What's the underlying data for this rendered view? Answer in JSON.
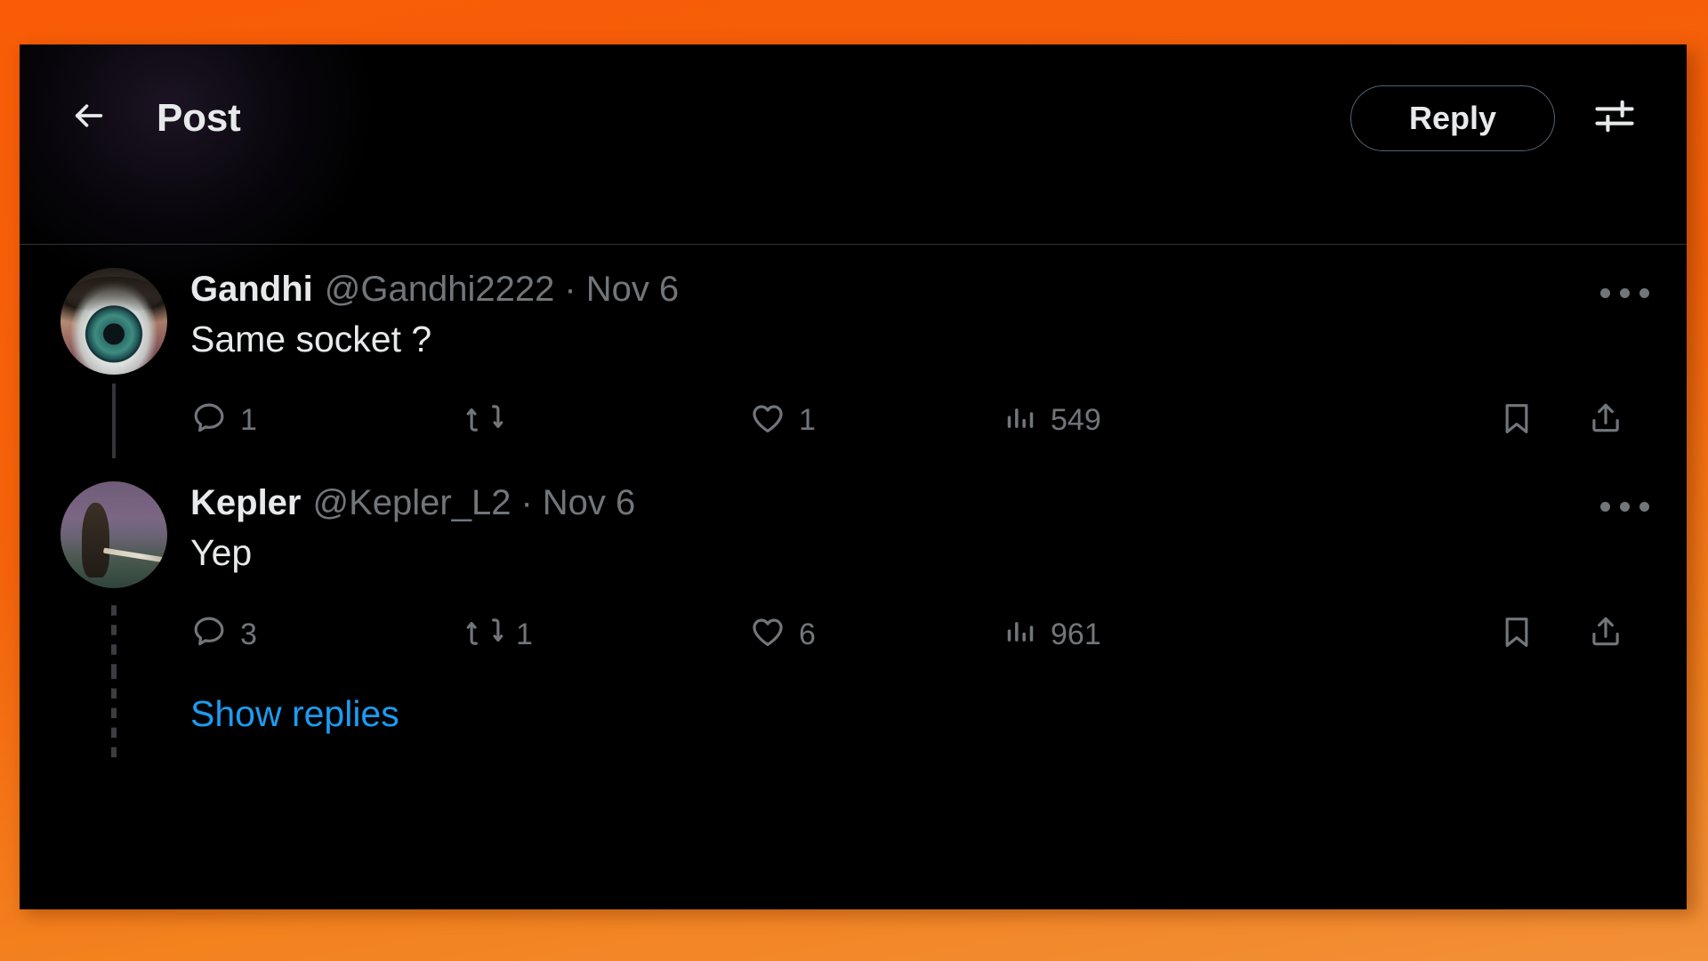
{
  "theme": {
    "frame_color": "#f4620a",
    "app_background": "#000000",
    "text_primary": "#e7e9ea",
    "text_secondary": "#71767b",
    "link_color": "#1d9bf0",
    "border_color": "#2f3336"
  },
  "header": {
    "back_icon": "arrow-left-icon",
    "title": "Post",
    "reply_label": "Reply",
    "settings_icon": "sliders-icon"
  },
  "posts": [
    {
      "avatar_style": "eye",
      "display_name": "Gandhi",
      "handle": "@Gandhi2222",
      "separator": "·",
      "date": "Nov 6",
      "text": "Same socket ?",
      "more_icon": "ellipsis-icon",
      "actions": {
        "reply_icon": "comment-icon",
        "reply_count": "1",
        "repost_icon": "retweet-icon",
        "repost_count": "",
        "like_icon": "heart-icon",
        "like_count": "1",
        "views_icon": "analytics-icon",
        "views_count": "549",
        "bookmark_icon": "bookmark-icon",
        "share_icon": "share-icon"
      }
    },
    {
      "avatar_style": "figure",
      "display_name": "Kepler",
      "handle": "@Kepler_L2",
      "separator": "·",
      "date": "Nov 6",
      "text": "Yep",
      "more_icon": "ellipsis-icon",
      "actions": {
        "reply_icon": "comment-icon",
        "reply_count": "3",
        "repost_icon": "retweet-icon",
        "repost_count": "1",
        "like_icon": "heart-icon",
        "like_count": "6",
        "views_icon": "analytics-icon",
        "views_count": "961",
        "bookmark_icon": "bookmark-icon",
        "share_icon": "share-icon"
      }
    }
  ],
  "show_replies": {
    "label": "Show replies"
  }
}
